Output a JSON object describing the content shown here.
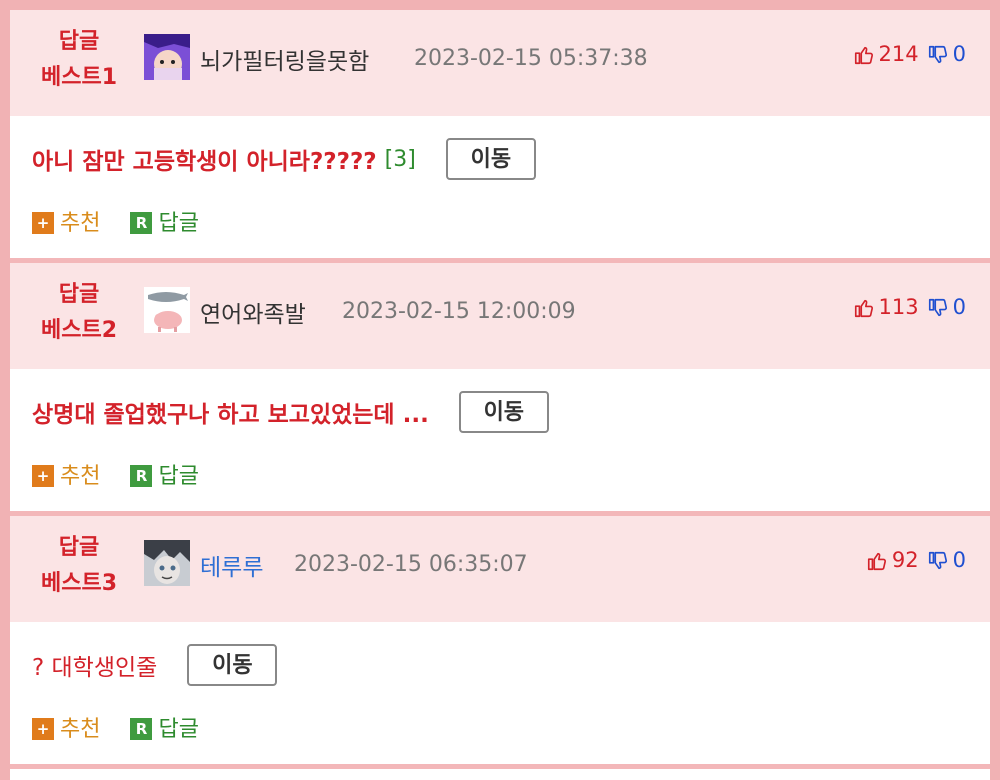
{
  "replies": [
    {
      "best_label_1": "답글",
      "best_label_2": "베스트1",
      "nickname": "뇌가필터링을못함",
      "date": "2023-02-15 05:37:38",
      "up": "214",
      "down": "0",
      "title": "아니 잠만 고등학생이 아니라?????",
      "comment_count": "[3]",
      "move_label": "이동",
      "recommend_label": "추천",
      "reply_label": "답글",
      "recommend_icon": "+",
      "reply_icon": "R"
    },
    {
      "best_label_1": "답글",
      "best_label_2": "베스트2",
      "nickname": "연어와족발",
      "date": "2023-02-15 12:00:09",
      "up": "113",
      "down": "0",
      "title": "상명대 졸업했구나 하고 보고있었는데 ...",
      "move_label": "이동",
      "recommend_label": "추천",
      "reply_label": "답글",
      "recommend_icon": "+",
      "reply_icon": "R"
    },
    {
      "best_label_1": "답글",
      "best_label_2": "베스트3",
      "nickname": "테루루",
      "date": "2023-02-15 06:35:07",
      "up": "92",
      "down": "0",
      "title": "? 대학생인줄",
      "move_label": "이동",
      "recommend_label": "추천",
      "reply_label": "답글",
      "recommend_icon": "+",
      "reply_icon": "R"
    }
  ],
  "colors": {
    "frame": "#f1b2b4",
    "header_bg": "#fbe4e5",
    "title_red": "#d3222a",
    "downvote_blue": "#1f4fd0",
    "recommend_orange": "#e07b1b",
    "reply_green": "#3f9b3f"
  },
  "icons": {
    "upvote": "thumbs-up-outline-icon",
    "downvote": "thumbs-down-outline-icon"
  }
}
